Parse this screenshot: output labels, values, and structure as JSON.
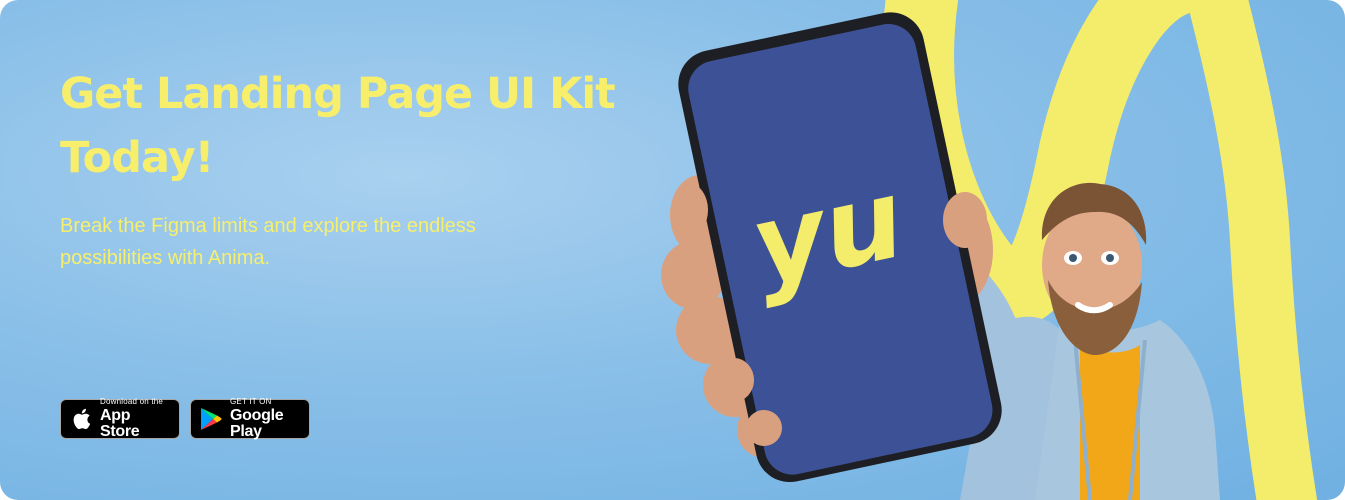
{
  "hero": {
    "headline": "Get Landing Page UI Kit Today!",
    "subtitle": "Break the Figma limits and explore the endless possibilities with Anima."
  },
  "store_buttons": {
    "apple": {
      "small": "Download on the",
      "big": "App Store",
      "icon": "apple-logo-icon"
    },
    "google": {
      "small": "GET IT ON",
      "big": "Google Play",
      "icon": "google-play-icon"
    }
  },
  "phone": {
    "screen_logo": "yu",
    "screen_color": "#3d5296",
    "logo_color": "#f4ec6b"
  },
  "colors": {
    "accent_yellow": "#f7ef6c",
    "background_blue": "#89bfe8",
    "shirt": "#f2a719",
    "jacket": "#a3c2dd"
  }
}
